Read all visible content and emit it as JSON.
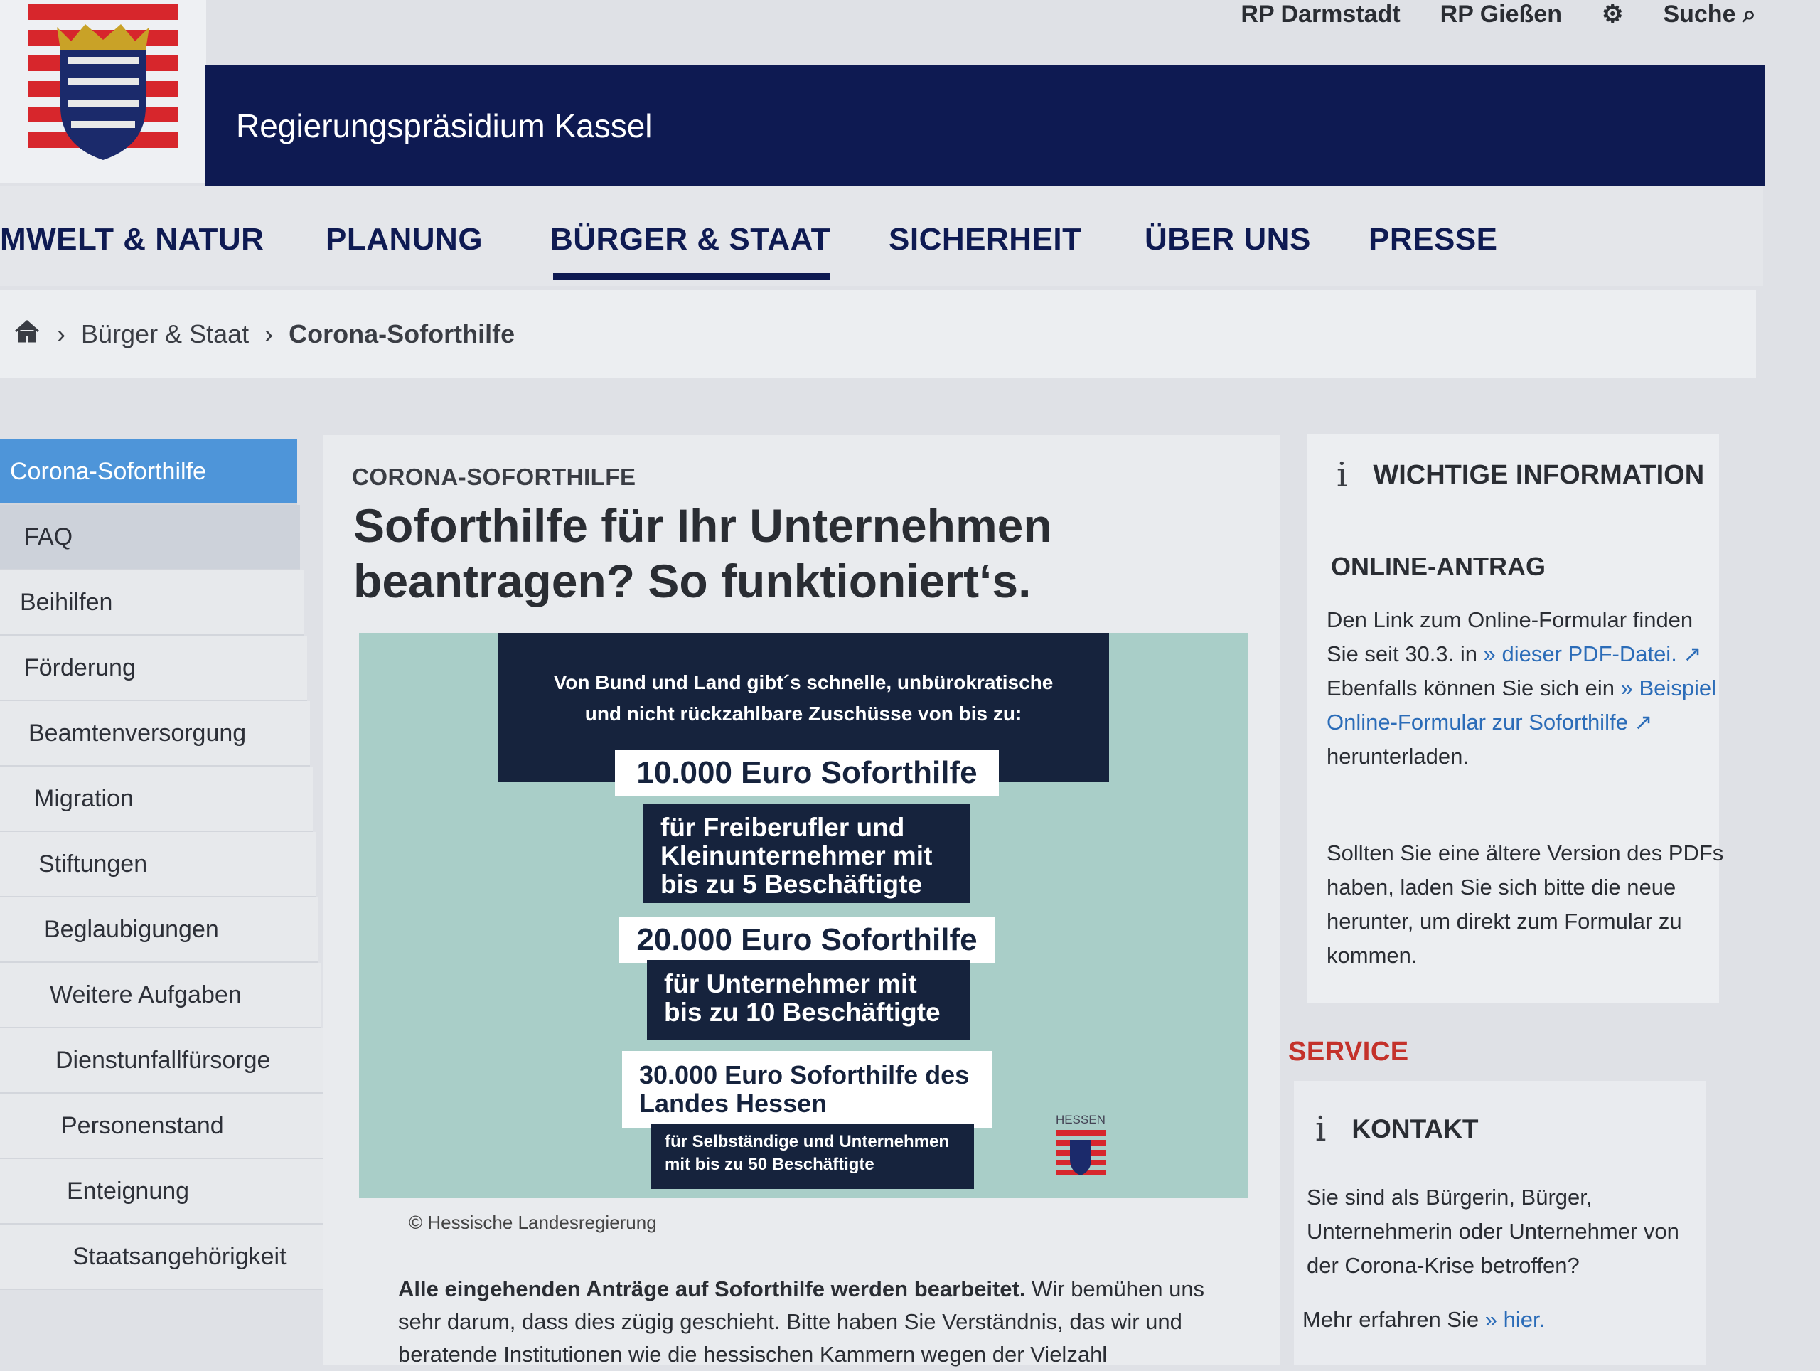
{
  "header": {
    "agency": "Regierungspräsidium Kassel",
    "top_links": [
      "RP Darmstadt",
      "RP Gießen"
    ],
    "search_label": "Suche"
  },
  "nav": {
    "items": [
      "MWELT & NATUR",
      "PLANUNG",
      "BÜRGER & STAAT",
      "SICHERHEIT",
      "ÜBER UNS",
      "PRESSE"
    ],
    "active": "BÜRGER & STAAT"
  },
  "breadcrumb": {
    "parent": "Bürger & Staat",
    "current": "Corona-Soforthilfe"
  },
  "sidebar": {
    "items": [
      "Corona-Soforthilfe",
      "FAQ",
      "Beihilfen",
      "Förderung",
      "Beamtenversorgung",
      "Migration",
      "Stiftungen",
      "Beglaubigungen",
      "Weitere Aufgaben",
      "Dienstunfallfürsorge",
      "Personenstand",
      "Enteignung",
      "Staatsangehörigkeit"
    ]
  },
  "article": {
    "kicker": "CORONA-SOFORTHILFE",
    "headline": "Soforthilfe für Ihr Unternehmen beantragen? So funktioniert‘s.",
    "infographic": {
      "intro_line1": "Von Bund und Land gibt´s schnelle, unbürokratische",
      "intro_line2": "und nicht rückzahlbare Zuschüsse von bis zu:",
      "tier1_amount": "10.000 Euro Soforthilfe",
      "tier1_desc": "für Freiberufler und Kleinunternehmer mit bis zu 5 Beschäftigte",
      "tier2_amount": "20.000 Euro Soforthilfe",
      "tier2_desc": "für Unternehmer mit bis zu 10 Beschäftigte",
      "tier3_amount": "30.000 Euro Soforthilfe des Landes Hessen",
      "tier3_desc": "für Selbständige und Unternehmen mit bis zu 50 Beschäftigte",
      "logo_text": "HESSEN"
    },
    "caption": "© Hessische Landesregierung",
    "para_bold": "Alle eingehenden Anträge auf Soforthilfe werden bearbeitet.",
    "para_rest": " Wir bemühen uns sehr darum, dass dies zügig geschieht. Bitte haben Sie Verständnis, das wir und beratende Institutionen wie die hessischen Kammern wegen der Vielzahl"
  },
  "aside": {
    "info_title": "WICHTIGE INFORMATION",
    "online_title": "ONLINE-ANTRAG",
    "online_text1": "Den Link zum Online-Formular finden Sie seit 30.3. in",
    "online_link1": "dieser PDF-Datei.",
    "online_text2": "Ebenfalls können Sie sich ein",
    "online_link2": "Beispiel Online-Formular zur Soforthilfe",
    "online_text3": "herunterladen.",
    "online_text4": "Sollten Sie eine ältere Version des PDFs haben, laden Sie sich bitte die neue herunter, um direkt zum Formular zu kommen.",
    "service_title": "SERVICE",
    "kontakt_title": "KONTAKT",
    "kontakt_text": "Sie sind als Bürgerin, Bürger, Unternehmerin oder Unternehmer von der Corona-Krise betroffen?",
    "kontakt_more": "Mehr erfahren  Sie",
    "kontakt_link": "hier."
  },
  "colors": {
    "brand_navy": "#0e1a52",
    "sidebar_active": "#4e95d9",
    "service_red": "#c4322b",
    "link_blue": "#2b6cb8"
  }
}
